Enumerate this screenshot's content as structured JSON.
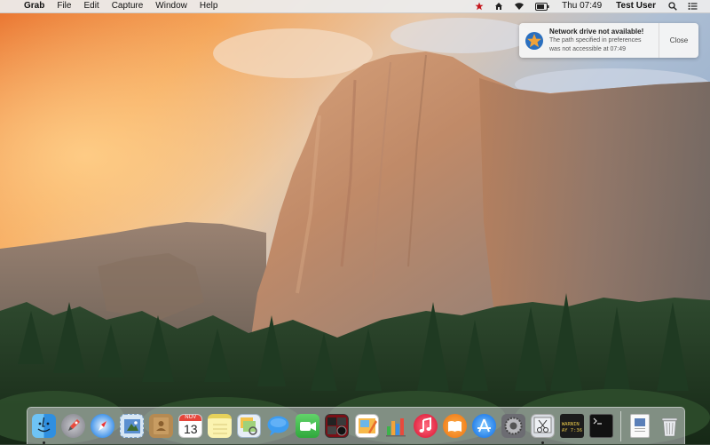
{
  "menubar": {
    "apple_glyph": "",
    "app_name": "Grab",
    "menus": [
      "File",
      "Edit",
      "Capture",
      "Window",
      "Help"
    ],
    "clock": "Thu 07:49",
    "user": "Test User"
  },
  "notification": {
    "title": "Network drive not available!",
    "message_line1": "The path specified in preferences",
    "message_line2": "was not accessible at 07:49",
    "close_label": "Close"
  },
  "dock": {
    "calendar_month": "NOV",
    "calendar_day": "13",
    "console_line1": "WARNIN",
    "console_line2": "AY 7:36"
  },
  "colors": {
    "accent_blue": "#1f7ae8",
    "status_red": "#c4161c"
  }
}
